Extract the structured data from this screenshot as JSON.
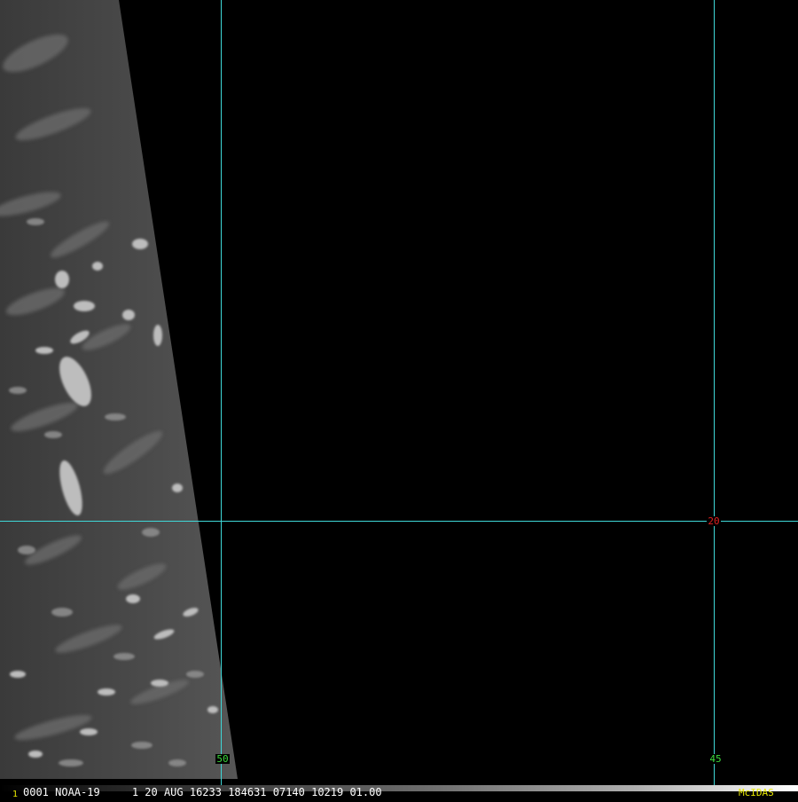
{
  "grid": {
    "lon_labels": [
      "50",
      "45"
    ],
    "lat_labels": [
      "20"
    ],
    "line_color": "#3fd8d8",
    "lon_label_color": "#3cdc3c",
    "lat_label_color": "#e02020"
  },
  "status": {
    "frame_marker": "1",
    "info": "0001 NOAA-19     1 20 AUG 16233 184631 07140 10219 01.00",
    "software": "McIDAS",
    "marker_color": "#e8e800",
    "info_color": "#ffffff",
    "software_color": "#e8e800"
  }
}
